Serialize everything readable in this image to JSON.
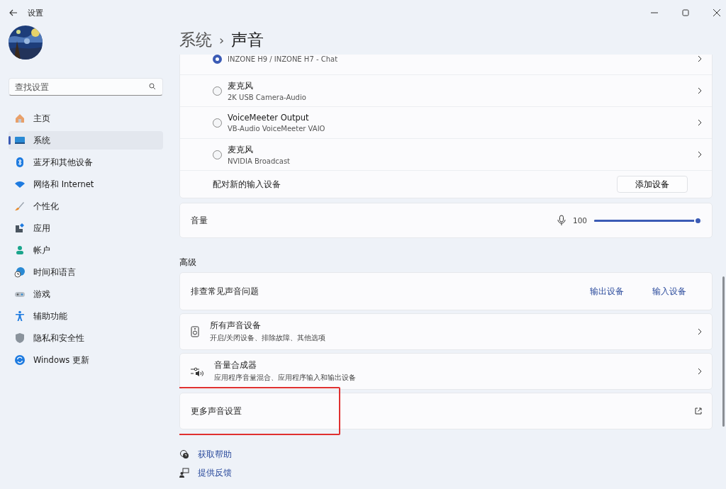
{
  "window": {
    "title": "设置"
  },
  "search": {
    "placeholder": "查找设置"
  },
  "nav": [
    {
      "label": "主页",
      "selected": false
    },
    {
      "label": "系统",
      "selected": true
    },
    {
      "label": "蓝牙和其他设备",
      "selected": false
    },
    {
      "label": "网络和 Internet",
      "selected": false
    },
    {
      "label": "个性化",
      "selected": false
    },
    {
      "label": "应用",
      "selected": false
    },
    {
      "label": "帐户",
      "selected": false
    },
    {
      "label": "时间和语言",
      "selected": false
    },
    {
      "label": "游戏",
      "selected": false
    },
    {
      "label": "辅助功能",
      "selected": false
    },
    {
      "label": "隐私和安全性",
      "selected": false
    },
    {
      "label": "Windows 更新",
      "selected": false
    }
  ],
  "breadcrumb": {
    "parent": "系统",
    "separator": "›",
    "current": "声音"
  },
  "input_devices": [
    {
      "subtitle": "INZONE H9 / INZONE H7 - Chat",
      "selected": true
    },
    {
      "name": "麦克风",
      "subtitle": "2K USB Camera-Audio",
      "selected": false
    },
    {
      "name": "VoiceMeeter Output",
      "subtitle": "VB-Audio VoiceMeeter VAIO",
      "selected": false
    },
    {
      "name": "麦克风",
      "subtitle": "NVIDIA Broadcast",
      "selected": false
    }
  ],
  "pair": {
    "label": "配对新的输入设备",
    "button": "添加设备"
  },
  "volume": {
    "label": "音量",
    "reading": "100",
    "level": 1
  },
  "advanced": {
    "heading": "高级",
    "troubleshoot": {
      "label": "排查常见声音问题",
      "links": [
        "输出设备",
        "输入设备"
      ]
    },
    "items": [
      {
        "kind": "nav",
        "title": "所有声音设备",
        "subtitle": "开启/关闭设备、排除故障、其他选项",
        "highlighted": false
      },
      {
        "kind": "nav",
        "title": "音量合成器",
        "subtitle": "应用程序音量混合、应用程序输入和输出设备",
        "highlighted": false
      },
      {
        "kind": "external",
        "title": "更多声音设置",
        "highlighted": true
      }
    ]
  },
  "help_links": [
    "获取帮助",
    "提供反馈"
  ]
}
